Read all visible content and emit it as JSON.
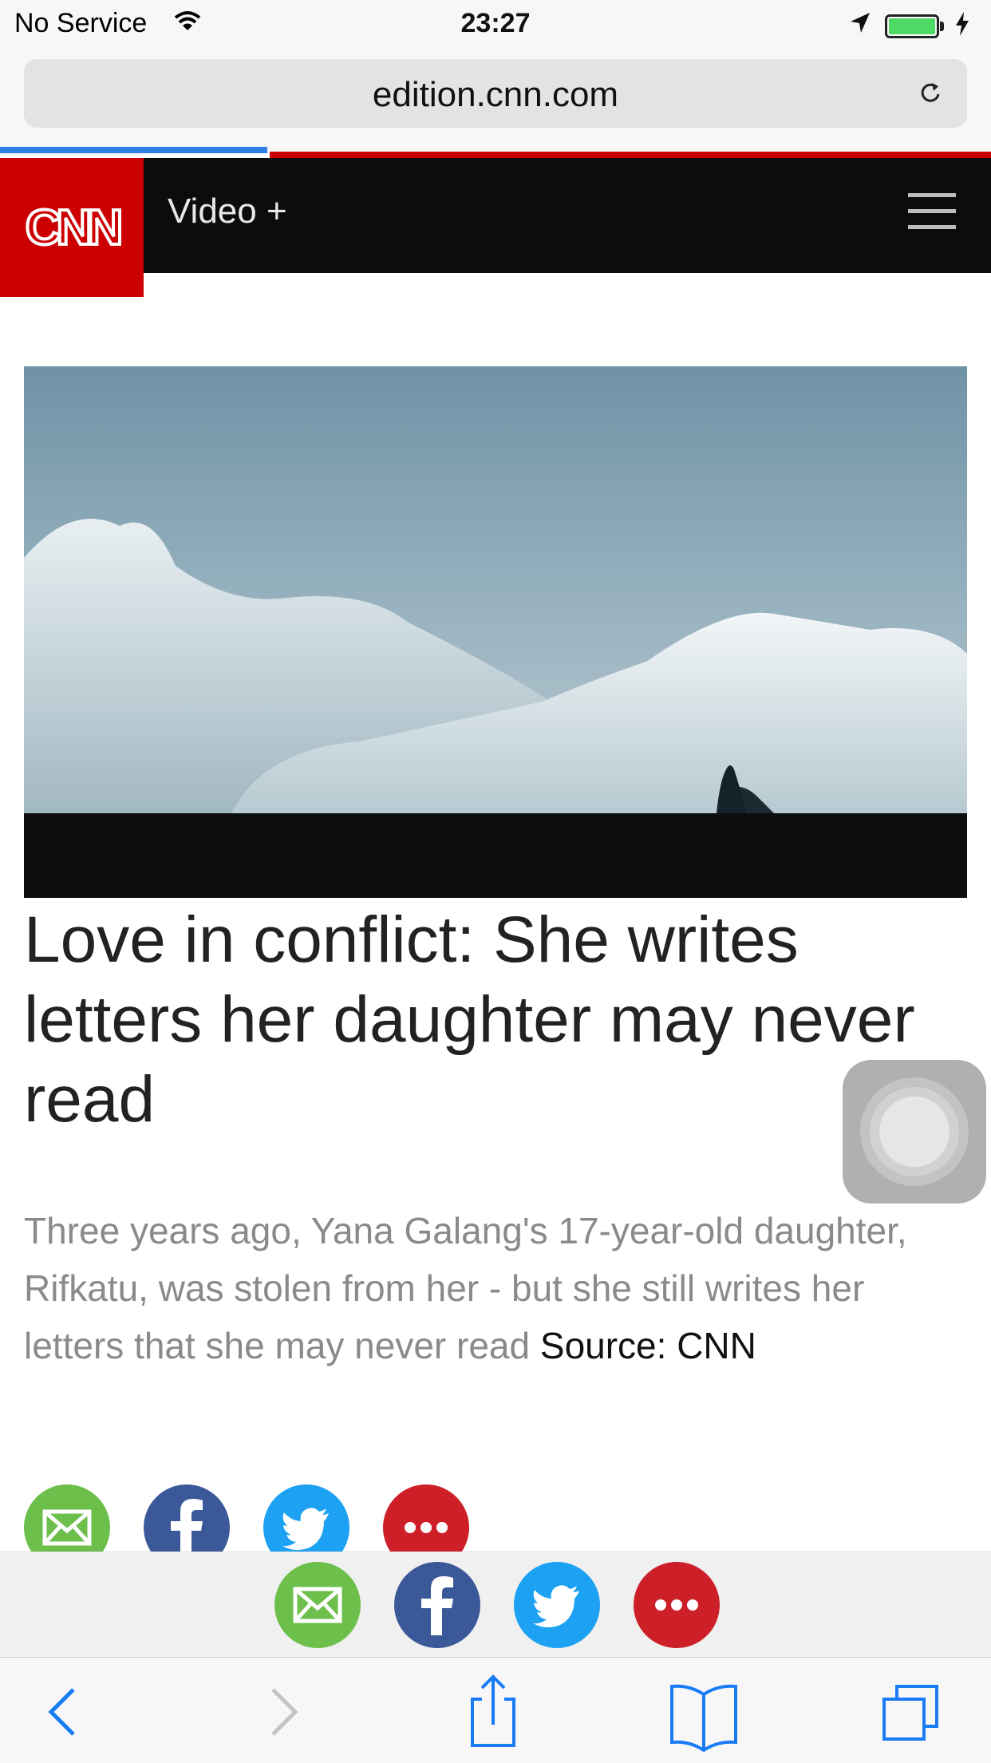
{
  "status_bar": {
    "carrier": "No Service",
    "time": "23:27"
  },
  "browser": {
    "url": "edition.cnn.com",
    "page_load_progress": 0.27
  },
  "site_header": {
    "logo": "CNN",
    "section": "Video +",
    "menu_icon": "hamburger-menu-icon"
  },
  "article": {
    "headline": "Love in conflict: She writes letters her daughter may never read",
    "description": "Three years ago, Yana Galang's 17-year-old daughter, Rifkatu, was stolen from her - but she still writes her letters that she may never read",
    "source": "Source: CNN"
  },
  "share": {
    "icons": [
      "email-icon",
      "facebook-icon",
      "twitter-icon",
      "more-icon"
    ],
    "colors": {
      "email": "#6dbf4b",
      "facebook": "#3b5998",
      "twitter": "#1da1f2",
      "more": "#cc1f27"
    }
  },
  "toolbar": {
    "icons": [
      "back-icon",
      "forward-icon",
      "share-icon",
      "bookmarks-icon",
      "tabs-icon"
    ]
  },
  "colors": {
    "cnn_red": "#cc0000",
    "accent_blue": "#2f7fe8"
  }
}
